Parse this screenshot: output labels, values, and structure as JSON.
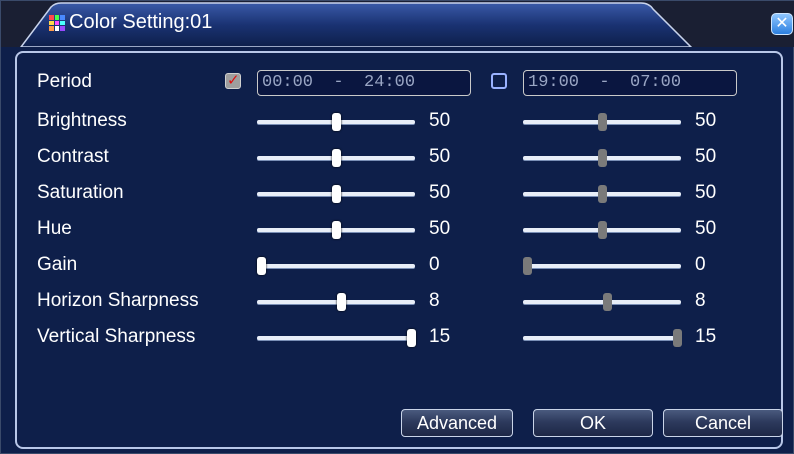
{
  "window": {
    "title": "Color Setting:01",
    "close_glyph": "✕"
  },
  "period": {
    "label": "Period",
    "slot1": {
      "checked": true,
      "start": "00:00",
      "end": "24:00"
    },
    "slot2": {
      "checked": false,
      "start": "19:00",
      "end": "07:00"
    },
    "separator": "-"
  },
  "rows": [
    {
      "label": "Brightness",
      "max": 100,
      "v1": 50,
      "v2": 50
    },
    {
      "label": "Contrast",
      "max": 100,
      "v1": 50,
      "v2": 50
    },
    {
      "label": "Saturation",
      "max": 100,
      "v1": 50,
      "v2": 50
    },
    {
      "label": "Hue",
      "max": 100,
      "v1": 50,
      "v2": 50
    },
    {
      "label": "Gain",
      "max": 100,
      "v1": 0,
      "v2": 0
    },
    {
      "label": "Horizon Sharpness",
      "max": 15,
      "v1": 8,
      "v2": 8
    },
    {
      "label": "Vertical Sharpness",
      "max": 15,
      "v1": 15,
      "v2": 15
    }
  ],
  "buttons": {
    "advanced": "Advanced",
    "ok": "OK",
    "cancel": "Cancel"
  },
  "colors": {
    "background": "#0e1f4a",
    "accent": "#b8c7e8",
    "checkmark": "#dd1111"
  }
}
